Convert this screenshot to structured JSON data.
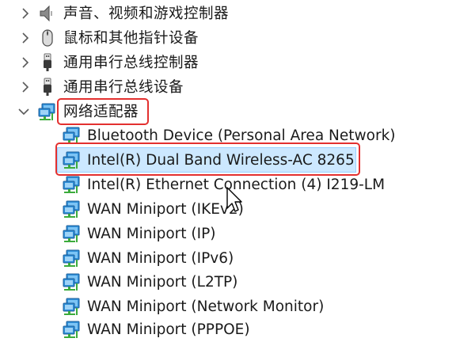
{
  "device_tree": {
    "collapsed_categories": [
      {
        "label": "声音、视频和游戏控制器",
        "icon": "speaker-icon"
      },
      {
        "label": "鼠标和其他指针设备",
        "icon": "mouse-icon"
      },
      {
        "label": "通用串行总线控制器",
        "icon": "usb-icon"
      },
      {
        "label": "通用串行总线设备",
        "icon": "usb-icon"
      }
    ],
    "expanded_category": {
      "label": "网络适配器",
      "icon": "network-adapter-icon"
    },
    "network_adapters": [
      {
        "label": "Bluetooth Device (Personal Area Network)",
        "icon": "network-adapter-icon"
      },
      {
        "label": "Intel(R) Dual Band Wireless-AC 8265",
        "icon": "network-adapter-icon",
        "selected": true
      },
      {
        "label": "Intel(R) Ethernet Connection (4) I219-LM",
        "icon": "network-adapter-icon"
      },
      {
        "label": "WAN Miniport (IKEv2)",
        "icon": "network-adapter-icon"
      },
      {
        "label": "WAN Miniport (IP)",
        "icon": "network-adapter-icon"
      },
      {
        "label": "WAN Miniport (IPv6)",
        "icon": "network-adapter-icon"
      },
      {
        "label": "WAN Miniport (L2TP)",
        "icon": "network-adapter-icon"
      },
      {
        "label": "WAN Miniport (Network Monitor)",
        "icon": "network-adapter-icon"
      },
      {
        "label": "WAN Miniport (PPPOE)",
        "icon": "network-adapter-icon"
      }
    ]
  },
  "colors": {
    "selection_bg": "#cce8ff",
    "annotation_red": "#e3302f",
    "monitor_blue": "#2f8fd8",
    "cable_green": "#3cab3c"
  }
}
